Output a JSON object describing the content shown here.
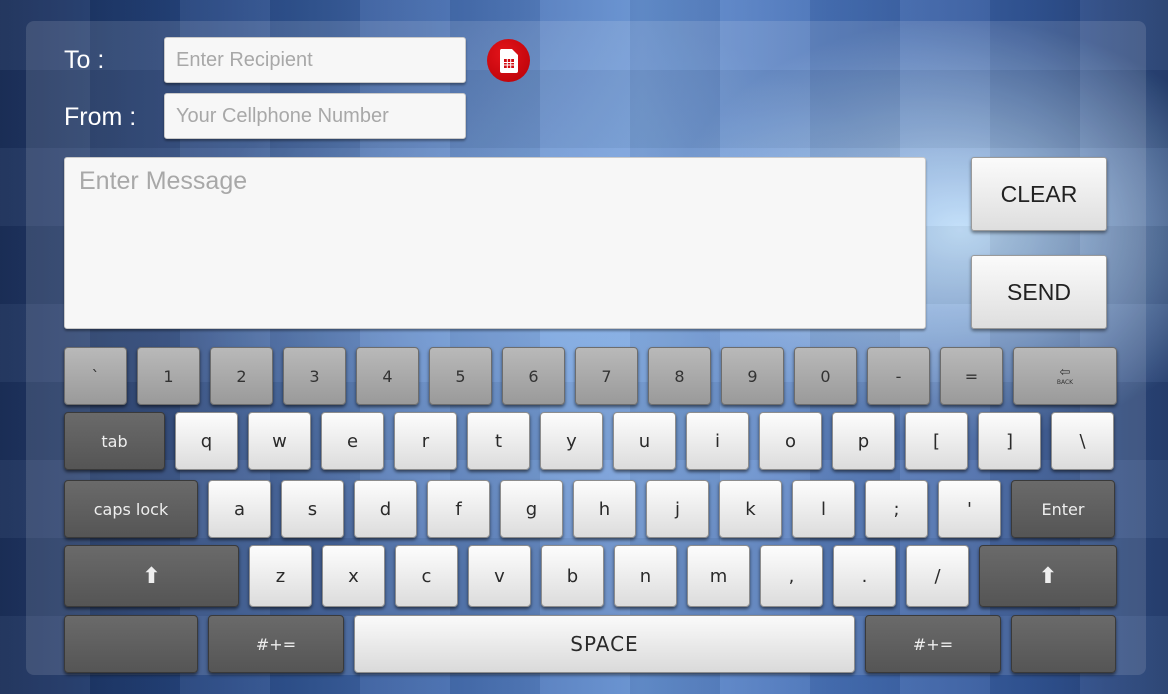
{
  "form": {
    "to_label": "To :",
    "to_placeholder": "Enter Recipient",
    "to_value": "",
    "from_label": "From :",
    "from_placeholder": "Your Cellphone Number",
    "from_value": "",
    "message_placeholder": "Enter Message",
    "message_value": "",
    "sim_icon": "sim-card-icon",
    "sim_icon_color": "#d10a10"
  },
  "actions": {
    "clear_label": "CLEAR",
    "send_label": "SEND"
  },
  "keyboard": {
    "row1": [
      "`",
      "1",
      "2",
      "3",
      "4",
      "5",
      "6",
      "7",
      "8",
      "9",
      "0",
      "-",
      "="
    ],
    "backspace_label": "BACK",
    "backspace_icon": "backspace-arrow-icon",
    "tab_label": "tab",
    "row2": [
      "q",
      "w",
      "e",
      "r",
      "t",
      "y",
      "u",
      "i",
      "o",
      "p",
      "[",
      "]",
      "\\"
    ],
    "caps_label": "caps lock",
    "row3": [
      "a",
      "s",
      "d",
      "f",
      "g",
      "h",
      "j",
      "k",
      "l",
      ";",
      "'"
    ],
    "enter_label": "Enter",
    "shift_icon": "shift-arrow-icon",
    "row4": [
      "z",
      "x",
      "c",
      "v",
      "b",
      "n",
      "m",
      ",",
      ".",
      "/"
    ],
    "symbols_label": "#+=",
    "space_label": "SPACE"
  },
  "colors": {
    "light_key": "#f0f0f0",
    "mid_key": "#a8a8a8",
    "dark_key": "#5f5f5f"
  }
}
